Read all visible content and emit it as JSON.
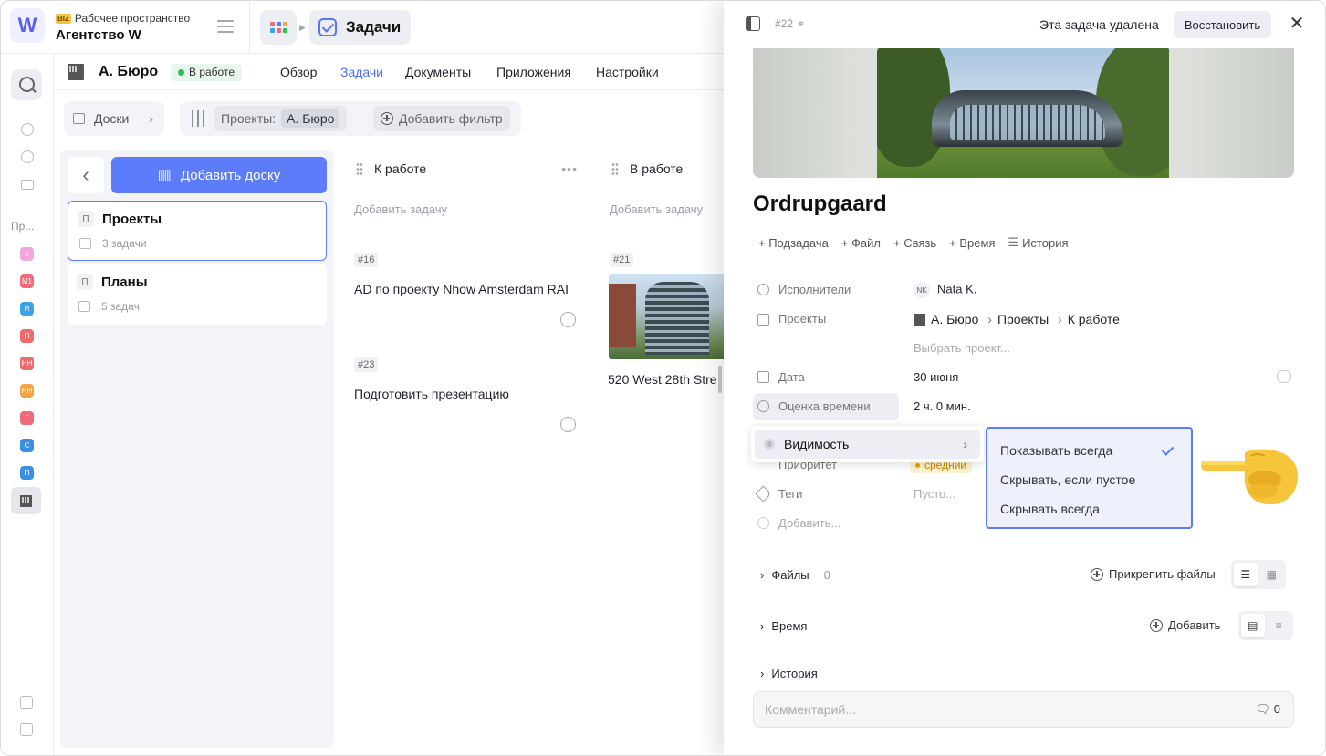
{
  "workspace": {
    "label": "Рабочее пространство",
    "badge": "BIZ",
    "name": "Агентство W",
    "logo": "W"
  },
  "breadcrumb": {
    "current": "Задачи"
  },
  "rail": {
    "section_label": "Пр...",
    "projects": [
      {
        "letter": "К",
        "color": "#f0a6d8"
      },
      {
        "letter": "M1",
        "color": "#f06a7a"
      },
      {
        "letter": "И",
        "color": "#3aa3e8"
      },
      {
        "letter": "П",
        "color": "#f06a6a"
      },
      {
        "letter": "НН",
        "color": "#f06a6a"
      },
      {
        "letter": "НН",
        "color": "#f5a442"
      },
      {
        "letter": "Г",
        "color": "#f06a7a"
      },
      {
        "letter": "С",
        "color": "#3a8fe8"
      },
      {
        "letter": "П",
        "color": "#3a8fe8"
      }
    ]
  },
  "project": {
    "title": "А. Бюро",
    "status": "В работе"
  },
  "nav": {
    "overview": "Обзор",
    "tasks": "Задачи",
    "documents": "Документы",
    "apps": "Приложения",
    "settings": "Настройки"
  },
  "toolbar": {
    "boards": "Доски",
    "filter_label": "Проекты:",
    "filter_value": "А. Бюро",
    "add_filter": "Добавить фильтр"
  },
  "boards": {
    "add": "Добавить доску",
    "items": [
      {
        "letter": "П",
        "title": "Проекты",
        "sub": "3 задачи"
      },
      {
        "letter": "П",
        "title": "Планы",
        "sub": "5 задач"
      }
    ]
  },
  "lanes": [
    {
      "title": "К работе",
      "add_task": "Добавить задачу",
      "tasks": [
        {
          "num": "#16",
          "title": "AD по проекту Nhow Amsterdam RAI"
        },
        {
          "num": "#23",
          "title": "Подготовить презентацию"
        }
      ]
    },
    {
      "title": "В работе",
      "add_task": "Добавить задачу",
      "tasks": [
        {
          "num": "#21",
          "title": "520 West 28th Stre"
        }
      ]
    }
  ],
  "panel": {
    "task_num": "#22",
    "deleted": "Эта задача удалена",
    "restore": "Восстановить",
    "title": "Ordrupgaard",
    "actions": {
      "subtask": "+ Подзадача",
      "file": "+ Файл",
      "link": "+ Связь",
      "time": "+ Время",
      "history": "История"
    },
    "props": {
      "assignees_label": "Исполнители",
      "assignee_initials": "NK",
      "assignee": "Nata K.",
      "projects_label": "Проекты",
      "path_ws": "А. Бюро",
      "path_board": "Проекты",
      "path_lane": "К работе",
      "choose_project": "Выбрать проект...",
      "date_label": "Дата",
      "date": "30 июня",
      "estimate_label": "Оценка времени",
      "estimate": "2 ч. 0 мин.",
      "priority_label": "Приоритет",
      "priority": "средний",
      "tags_label": "Теги",
      "tags": "Пусто...",
      "add_prop": "Добавить..."
    },
    "visibility_menu": {
      "label": "Видимость"
    },
    "visibility_options": [
      "Показывать всегда",
      "Скрывать, если пустое",
      "Скрывать всегда"
    ],
    "files": {
      "label": "Файлы",
      "count": "0",
      "attach": "Прикрепить файлы"
    },
    "time": {
      "label": "Время",
      "add": "Добавить"
    },
    "history": {
      "label": "История"
    },
    "comment": {
      "placeholder": "Комментарий...",
      "count": "0"
    }
  },
  "pointer_emoji": "👉"
}
